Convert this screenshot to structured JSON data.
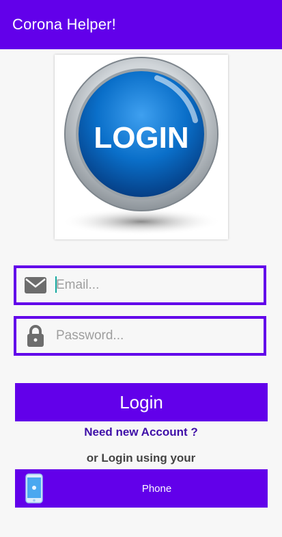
{
  "app_bar": {
    "title": "Corona Helper!"
  },
  "logo": {
    "text": "LOGIN",
    "icon": "login-button-image"
  },
  "email_field": {
    "placeholder": "Email...",
    "value": "",
    "icon": "envelope-icon"
  },
  "password_field": {
    "placeholder": "Password...",
    "value": "",
    "icon": "lock-icon"
  },
  "login_button": {
    "label": "Login"
  },
  "need_account_link": {
    "label": "Need new Account ?"
  },
  "alt_login_text": {
    "label": "or Login using your"
  },
  "phone_button": {
    "label": "Phone",
    "icon": "phone-icon"
  },
  "colors": {
    "primary": "#6200ea",
    "link": "#3f0fa8",
    "background": "#f7f7f7"
  }
}
